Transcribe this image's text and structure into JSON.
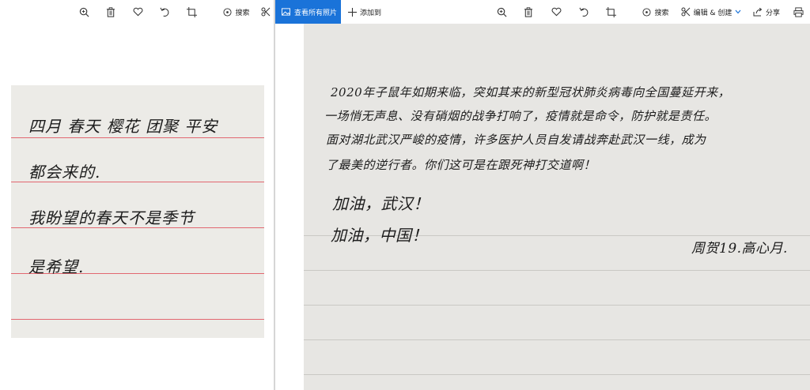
{
  "left_pane": {
    "toolbar": {
      "zoom_icon": "zoom-in-icon",
      "delete_icon": "trash-icon",
      "favorite_icon": "heart-icon",
      "rotate_icon": "rotate-icon",
      "crop_icon": "crop-icon",
      "search_label": "搜索"
    },
    "photo_lines": [
      "四月 春天 樱花 团聚 平安",
      "都会来的.",
      "我盼望的春天不是季节",
      "是希望."
    ]
  },
  "right_pane": {
    "toolbar": {
      "view_all_label": "查看所有照片",
      "add_to_label": "添加到",
      "search_label": "搜索",
      "edit_create_label": "编辑 & 创建",
      "share_label": "分享"
    },
    "photo_lines": [
      "2020年子鼠年如期来临，突如其来的新型冠状肺炎病毒向全国蔓延开来，",
      "一场悄无声息、没有硝烟的战争打响了，疫情就是命令，防护就是责任。",
      "面对湖北武汉严峻的疫情，许多医护人员自发请战奔赴武汉一线，成为",
      "了最美的逆行者。你们这可是在跟死神打交道啊！",
      "加油，武汉！",
      "加油，中国！"
    ],
    "signature": "周贺19.高心月."
  },
  "colors": {
    "accent": "#1a73d9",
    "rule_red": "#e0505a"
  }
}
